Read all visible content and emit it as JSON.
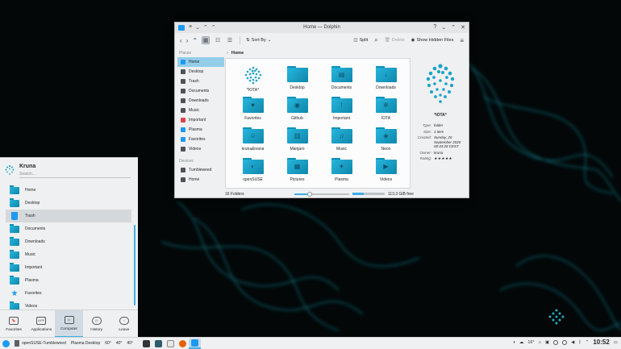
{
  "dolphin": {
    "title": "Home — Dolphin",
    "toolbar": {
      "sort_label": "Sort By",
      "split_label": "Split",
      "delete_label": "Delete",
      "hidden_label": "Show Hidden Files"
    },
    "places_header": "Places",
    "places": [
      "Home",
      "Desktop",
      "Trash",
      "Documents",
      "Downloads",
      "Music",
      "Important",
      "Plasma",
      "Favorites",
      "Videos"
    ],
    "devices_header": "Devices",
    "devices": [
      "Tumbleweed",
      "Home"
    ],
    "breadcrumb": "Home",
    "files": [
      {
        "name": "*IOTA*",
        "kind": "iota"
      },
      {
        "name": "Desktop",
        "kind": "folder",
        "glyph": ""
      },
      {
        "name": "Documents",
        "kind": "folder",
        "glyph": "▤"
      },
      {
        "name": "Downloads",
        "kind": "folder",
        "glyph": "↓"
      },
      {
        "name": "Favorites",
        "kind": "folder",
        "glyph": "♥"
      },
      {
        "name": "Github",
        "kind": "folder",
        "glyph": "◉"
      },
      {
        "name": "Important",
        "kind": "folder",
        "glyph": "!"
      },
      {
        "name": "IOTA",
        "kind": "folder",
        "glyph": "✲"
      },
      {
        "name": "kruna&ivana",
        "kind": "folder",
        "glyph": "☺"
      },
      {
        "name": "Manjaro",
        "kind": "folder",
        "glyph": "▥"
      },
      {
        "name": "Music",
        "kind": "folder",
        "glyph": "♫"
      },
      {
        "name": "Neon",
        "kind": "folder",
        "glyph": "◈"
      },
      {
        "name": "openSUSE",
        "kind": "folder",
        "glyph": "◐"
      },
      {
        "name": "Pictures",
        "kind": "folder",
        "glyph": "▦"
      },
      {
        "name": "Plasma",
        "kind": "folder",
        "glyph": "✦"
      },
      {
        "name": "Videos",
        "kind": "folder",
        "glyph": "▶"
      }
    ],
    "info": {
      "name": "*IOTA*",
      "type_label": "Type:",
      "type": "folder",
      "size_label": "Size:",
      "size": "1 item",
      "created_label": "Created:",
      "created": "Sunday, 20 September 2020 00:43:28 CEST",
      "owner_label": "Owner:",
      "owner": "kruna",
      "rating_label": "Rating:",
      "rating": "★★★★★"
    },
    "status": {
      "count": "16 Folders",
      "free": "113.3 GiB free",
      "zoom_fraction": 0.28,
      "used_fraction": 0.35
    }
  },
  "launcher": {
    "user": "Kruna",
    "search_placeholder": "Search...",
    "items": [
      "Home",
      "Desktop",
      "Trash",
      "Documents",
      "Downloads",
      "Music",
      "Important",
      "Plasma",
      "Favorites",
      "Videos"
    ],
    "tabs": [
      "Favorites",
      "Applications",
      "Computer",
      "History",
      "Leave"
    ]
  },
  "taskbar": {
    "window_title": "openSUSE-Tumbleweed",
    "activity": "Plasma Desktop",
    "temps": [
      "60°",
      "40°",
      "40°"
    ],
    "weather": "16°",
    "clock": "10:52"
  },
  "colors": {
    "accent": "#3daee9",
    "folder": "#1aa3cc",
    "selection": "#93cee9"
  }
}
